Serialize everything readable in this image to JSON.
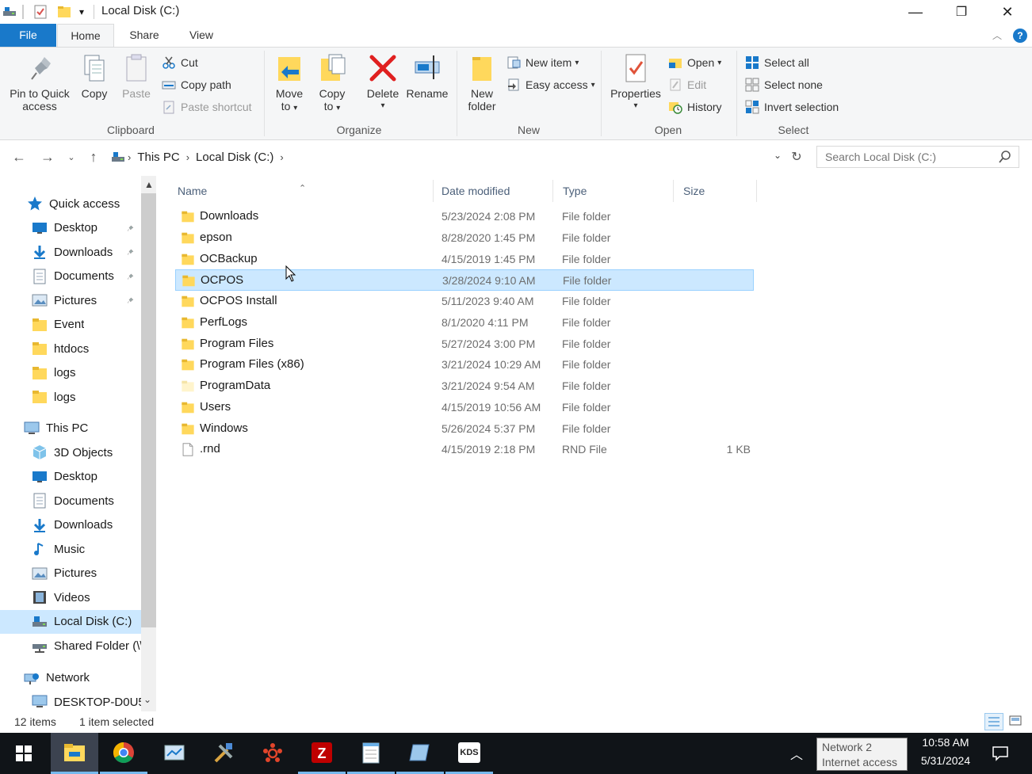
{
  "window": {
    "title": "Local Disk (C:)",
    "controls": {
      "minimize": "—",
      "restore": "❐",
      "close": "✕"
    }
  },
  "ribbon_tabs": [
    "File",
    "Home",
    "Share",
    "View"
  ],
  "ribbon": {
    "clipboard": {
      "label": "Clipboard",
      "pin_label_1": "Pin to Quick",
      "pin_label_2": "access",
      "copy": "Copy",
      "paste": "Paste",
      "cut": "Cut",
      "copy_path": "Copy path",
      "paste_shortcut": "Paste shortcut"
    },
    "organize": {
      "label": "Organize",
      "move_1": "Move",
      "move_2": "to",
      "copy_1": "Copy",
      "copy_2": "to",
      "delete": "Delete",
      "rename": "Rename"
    },
    "new": {
      "label": "New",
      "new_folder_1": "New",
      "new_folder_2": "folder",
      "new_item": "New item",
      "easy_access": "Easy access"
    },
    "open": {
      "label": "Open",
      "properties": "Properties",
      "open": "Open",
      "edit": "Edit",
      "history": "History"
    },
    "select": {
      "label": "Select",
      "select_all": "Select all",
      "select_none": "Select none",
      "invert_selection": "Invert selection"
    }
  },
  "address": {
    "crumbs": [
      "This PC",
      "Local Disk (C:)"
    ],
    "search_placeholder": "Search Local Disk (C:)"
  },
  "navpane": {
    "quick_access": "Quick access",
    "quick_items": [
      {
        "label": "Desktop",
        "icon": "desktop-icon",
        "pinned": true
      },
      {
        "label": "Downloads",
        "icon": "download-arrow-icon",
        "pinned": true
      },
      {
        "label": "Documents",
        "icon": "document-icon",
        "pinned": true
      },
      {
        "label": "Pictures",
        "icon": "pictures-icon",
        "pinned": true
      },
      {
        "label": "Event",
        "icon": "folder-icon",
        "pinned": false
      },
      {
        "label": "htdocs",
        "icon": "folder-icon",
        "pinned": false
      },
      {
        "label": "logs",
        "icon": "folder-icon",
        "pinned": false
      },
      {
        "label": "logs",
        "icon": "folder-icon",
        "pinned": false
      }
    ],
    "this_pc": "This PC",
    "pc_items": [
      {
        "label": "3D Objects",
        "icon": "3d-objects-icon"
      },
      {
        "label": "Desktop",
        "icon": "desktop-icon"
      },
      {
        "label": "Documents",
        "icon": "document-icon"
      },
      {
        "label": "Downloads",
        "icon": "download-arrow-icon"
      },
      {
        "label": "Music",
        "icon": "music-icon"
      },
      {
        "label": "Pictures",
        "icon": "pictures-icon"
      },
      {
        "label": "Videos",
        "icon": "videos-icon"
      },
      {
        "label": "Local Disk (C:)",
        "icon": "drive-icon"
      },
      {
        "label": "Shared Folder (\\\\",
        "icon": "network-drive-icon"
      }
    ],
    "network": "Network",
    "network_item": "DESKTOP-D0U5("
  },
  "columns": {
    "name": "Name",
    "date": "Date modified",
    "type": "Type",
    "size": "Size"
  },
  "files": [
    {
      "name": "Downloads",
      "date": "5/23/2024 2:08 PM",
      "type": "File folder",
      "size": "",
      "kind": "folder"
    },
    {
      "name": "epson",
      "date": "8/28/2020 1:45 PM",
      "type": "File folder",
      "size": "",
      "kind": "folder"
    },
    {
      "name": "OCBackup",
      "date": "4/15/2019 1:45 PM",
      "type": "File folder",
      "size": "",
      "kind": "folder"
    },
    {
      "name": "OCPOS",
      "date": "3/28/2024 9:10 AM",
      "type": "File folder",
      "size": "",
      "kind": "folder"
    },
    {
      "name": "OCPOS Install",
      "date": "5/11/2023 9:40 AM",
      "type": "File folder",
      "size": "",
      "kind": "folder"
    },
    {
      "name": "PerfLogs",
      "date": "8/1/2020 4:11 PM",
      "type": "File folder",
      "size": "",
      "kind": "folder"
    },
    {
      "name": "Program Files",
      "date": "5/27/2024 3:00 PM",
      "type": "File folder",
      "size": "",
      "kind": "folder"
    },
    {
      "name": "Program Files (x86)",
      "date": "3/21/2024 10:29 AM",
      "type": "File folder",
      "size": "",
      "kind": "folder"
    },
    {
      "name": "ProgramData",
      "date": "3/21/2024 9:54 AM",
      "type": "File folder",
      "size": "",
      "kind": "folder-hidden"
    },
    {
      "name": "Users",
      "date": "4/15/2019 10:56 AM",
      "type": "File folder",
      "size": "",
      "kind": "folder"
    },
    {
      "name": "Windows",
      "date": "5/26/2024 5:37 PM",
      "type": "File folder",
      "size": "",
      "kind": "folder"
    },
    {
      "name": ".rnd",
      "date": "4/15/2019 2:18 PM",
      "type": "RND File",
      "size": "1 KB",
      "kind": "file"
    }
  ],
  "selected_file": "OCPOS",
  "status": {
    "count": "12 items",
    "selection": "1 item selected"
  },
  "taskbar": {
    "apps": [
      "start-icon",
      "file-explorer-icon",
      "chrome-icon",
      "control-panel-icon",
      "tools-icon",
      "network-app-icon",
      "filezilla-icon",
      "notepad-icon",
      "remote-app-icon",
      "kds-icon"
    ],
    "kds_label": "KDS",
    "time": "10:58 AM",
    "date": "5/31/2024",
    "tooltip_line1": "Network 2",
    "tooltip_line2": "Internet access"
  },
  "colors": {
    "accent": "#1979ca",
    "selection": "#cce8ff",
    "folder": "#ffd85c",
    "taskbar": "#101418"
  }
}
